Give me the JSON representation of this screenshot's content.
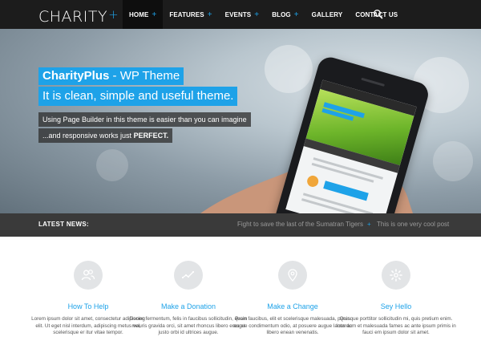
{
  "header": {
    "logo": "CHARITY",
    "logo_plus": "+",
    "nav": [
      {
        "label": "HOME",
        "plus": "+"
      },
      {
        "label": "FEATURES",
        "plus": "+"
      },
      {
        "label": "EVENTS",
        "plus": "+"
      },
      {
        "label": "BLOG",
        "plus": "+"
      },
      {
        "label": "GALLERY",
        "plus": ""
      },
      {
        "label": "CONTACT US",
        "plus": ""
      }
    ],
    "active_index": 0,
    "search_icon": "search-icon"
  },
  "hero": {
    "title_bold": "CharityPlus",
    "title_rest": " - WP Theme",
    "subtitle": "It is clean, simple and useful theme.",
    "line1": "Using Page Builder in this theme is easier than you can imagine",
    "line2_pre": "...and responsive works just ",
    "line2_bold": "PERFECT."
  },
  "news": {
    "label": "LATEST NEWS:",
    "items": [
      "Fight to save the last of the Sumatran Tigers",
      "This is one very cool post"
    ],
    "item_plus": "+"
  },
  "features": [
    {
      "icon": "users-icon",
      "title": "How To Help",
      "text": "Lorem ipsum dolor sit amet, consectetur adipiscing elit. Ut eget nisl interdum, adipiscing metus vel, scelerisque er itur vitae tempor."
    },
    {
      "icon": "chart-line-icon",
      "title": "Make a Donation",
      "text": "Donec fermentum, felis in faucibus sollicitudin, quam mauris gravida orci, sit amet rhoncus libero eros et justo orbi id ultrices augue."
    },
    {
      "icon": "map-pin-icon",
      "title": "Make a Change",
      "text": "Proin faucibus, elit et scelerisque malesuada, purus augue condimentum odio, at posuere augue lacus ac libero enean venenatis."
    },
    {
      "icon": "gear-icon",
      "title": "Sey Hello",
      "text": "Quisque porttitor sollicitudin mi, quis pretium enim. Interdum et malesuada fames ac ante ipsum primis in fauci em ipsum dolor sit amet."
    }
  ],
  "colors": {
    "accent": "#1ea2e8",
    "header_bg": "#1c1c1c",
    "news_bg": "#3a3a3a",
    "feature_circle": "#e2e4e6"
  }
}
